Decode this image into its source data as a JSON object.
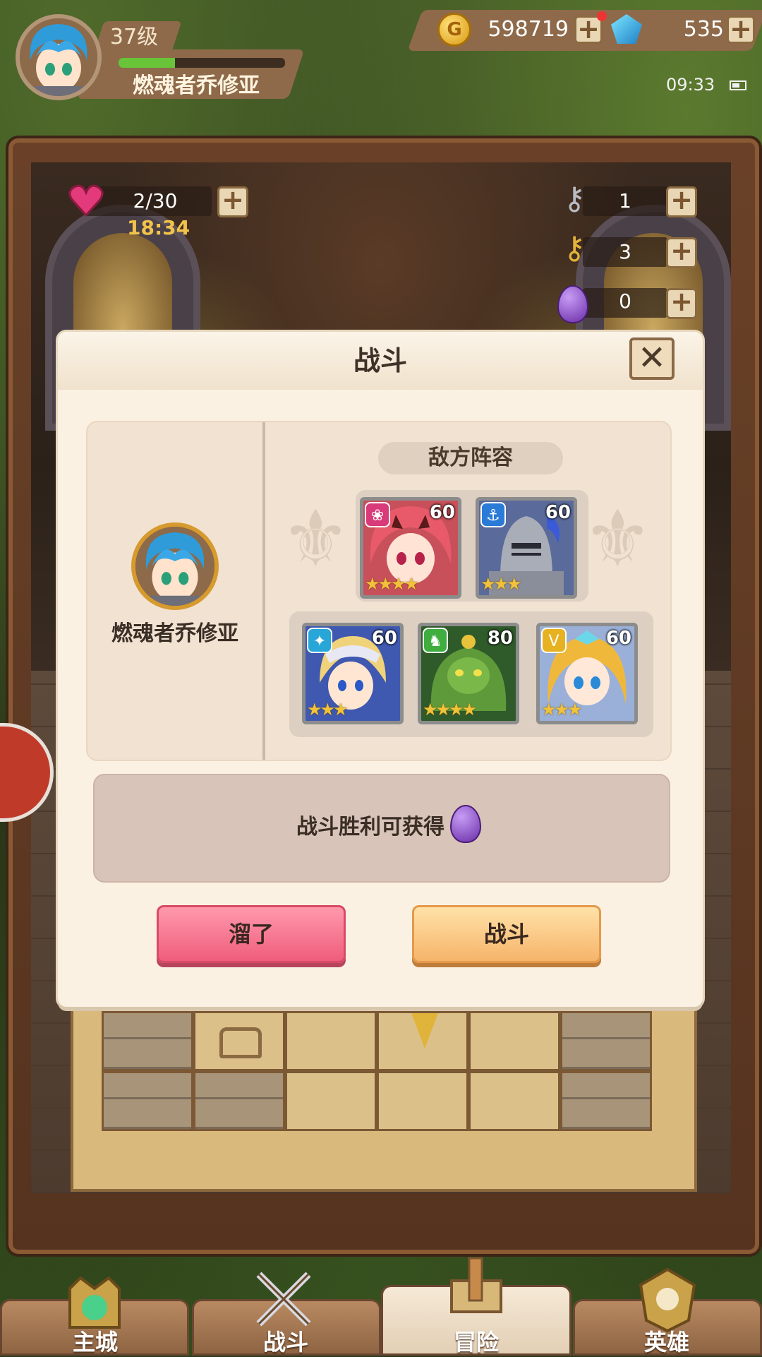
{
  "player": {
    "level": "37级",
    "name": "燃魂者乔修亚",
    "exp_fraction": 0.34
  },
  "resources": {
    "gold": "598719",
    "gems": "535",
    "plus": "+"
  },
  "status_bar": {
    "time": "09:33"
  },
  "dungeon": {
    "stamina": "2/30",
    "stamina_timer": "18:34",
    "silver_keys": "1",
    "gold_keys": "3",
    "eggs": "0"
  },
  "dialog": {
    "title": "战斗",
    "close": "✕",
    "player_name": "燃魂者乔修亚",
    "enemy_label": "敌方阵容",
    "enemies": [
      {
        "level": "60",
        "faction_icon": "lotus-icon",
        "faction_glyph": "❀",
        "faction_color": "#d83a7a",
        "stars": "★★★★",
        "art": "red-hair-girl"
      },
      {
        "level": "60",
        "faction_icon": "anchor-icon",
        "faction_glyph": "⚓",
        "faction_color": "#2a7bd8",
        "stars": "★★★",
        "art": "armored-knight"
      },
      {
        "level": "60",
        "faction_icon": "gear-icon",
        "faction_glyph": "✦",
        "faction_color": "#29a6d8",
        "stars": "★★★",
        "art": "blonde-boy"
      },
      {
        "level": "80",
        "faction_icon": "dragon-icon",
        "faction_glyph": "♞",
        "faction_color": "#3fae3f",
        "stars": "★★★★",
        "art": "green-beast"
      },
      {
        "level": "60",
        "faction_icon": "chevron-icon",
        "faction_glyph": "V",
        "faction_color": "#e7b221",
        "stars": "★★★",
        "art": "blonde-girl"
      }
    ],
    "reward_text": "战斗胜利可获得",
    "flee_button": "溜了",
    "fight_button": "战斗"
  },
  "nav": {
    "tabs": [
      {
        "label": "主城",
        "icon": "castle-icon"
      },
      {
        "label": "战斗",
        "icon": "crossed-swords-icon"
      },
      {
        "label": "冒险",
        "icon": "scroll-map-icon",
        "active": true
      },
      {
        "label": "英雄",
        "icon": "hero-emblem-icon"
      }
    ]
  },
  "colors": {
    "accent_flee": "#ef5d7c",
    "accent_fight": "#f6b46a",
    "dialog_bg": "#fbf1e3"
  }
}
